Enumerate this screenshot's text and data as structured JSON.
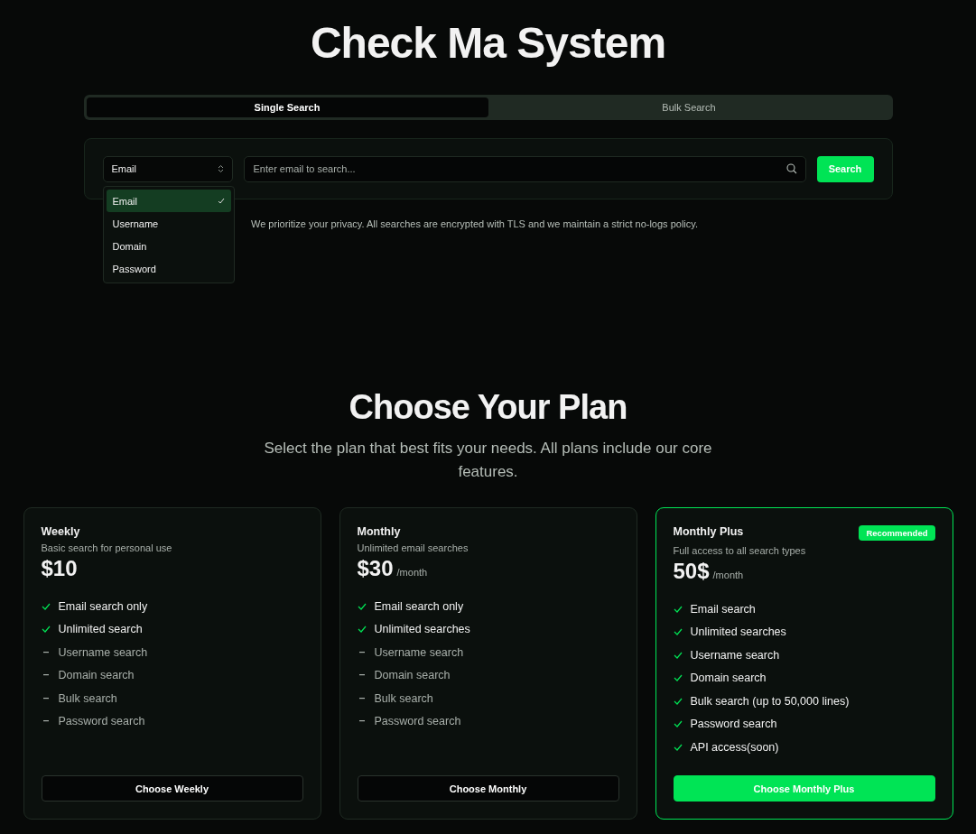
{
  "title": "Check Ma System",
  "tabs": [
    {
      "label": "Single Search",
      "selected": true
    },
    {
      "label": "Bulk Search",
      "selected": false
    }
  ],
  "search": {
    "type_select": "Email",
    "placeholder": "Enter email to search...",
    "button": "Search",
    "dropdown": {
      "expanded": true,
      "options": [
        {
          "label": "Email",
          "selected": true
        },
        {
          "label": "Username",
          "selected": false
        },
        {
          "label": "Domain",
          "selected": false
        },
        {
          "label": "Password",
          "selected": false
        }
      ]
    }
  },
  "privacy_note": "We prioritize your privacy. All searches are encrypted with TLS and we maintain a strict no-logs policy.",
  "plans_section": {
    "heading": "Choose Your Plan",
    "subtitle": "Select the plan that best fits your needs. All plans include our core features.",
    "plans": [
      {
        "name": "Weekly",
        "description": "Basic search for personal use",
        "price": "$10",
        "highlighted": false,
        "button": "Choose Weekly",
        "features": [
          {
            "label": "Email search only",
            "included": true
          },
          {
            "label": "Unlimited search",
            "included": true
          },
          {
            "label": "Username search",
            "included": false
          },
          {
            "label": "Domain search",
            "included": false
          },
          {
            "label": "Bulk search",
            "included": false
          },
          {
            "label": "Password search",
            "included": false
          }
        ]
      },
      {
        "name": "Monthly",
        "description": "Unlimited email searches",
        "price": "$30",
        "period": "/month",
        "highlighted": false,
        "button": "Choose Monthly",
        "features": [
          {
            "label": "Email search only",
            "included": true
          },
          {
            "label": "Unlimited searches",
            "included": true
          },
          {
            "label": "Username search",
            "included": false
          },
          {
            "label": "Domain search",
            "included": false
          },
          {
            "label": "Bulk search",
            "included": false
          },
          {
            "label": "Password search",
            "included": false
          }
        ]
      },
      {
        "name": "Monthly Plus",
        "description": "Full access to all search types",
        "price": "50$",
        "period": "/month",
        "badge": "Recommended",
        "highlighted": true,
        "button": "Choose Monthly Plus",
        "features": [
          {
            "label": "Email search",
            "included": true
          },
          {
            "label": "Unlimited searches",
            "included": true
          },
          {
            "label": "Username search",
            "included": true
          },
          {
            "label": "Domain search",
            "included": true
          },
          {
            "label": "Bulk search (up to 50,000 lines)",
            "included": true
          },
          {
            "label": "Password search",
            "included": true
          },
          {
            "label": "API access(soon)",
            "included": true
          }
        ]
      }
    ]
  }
}
